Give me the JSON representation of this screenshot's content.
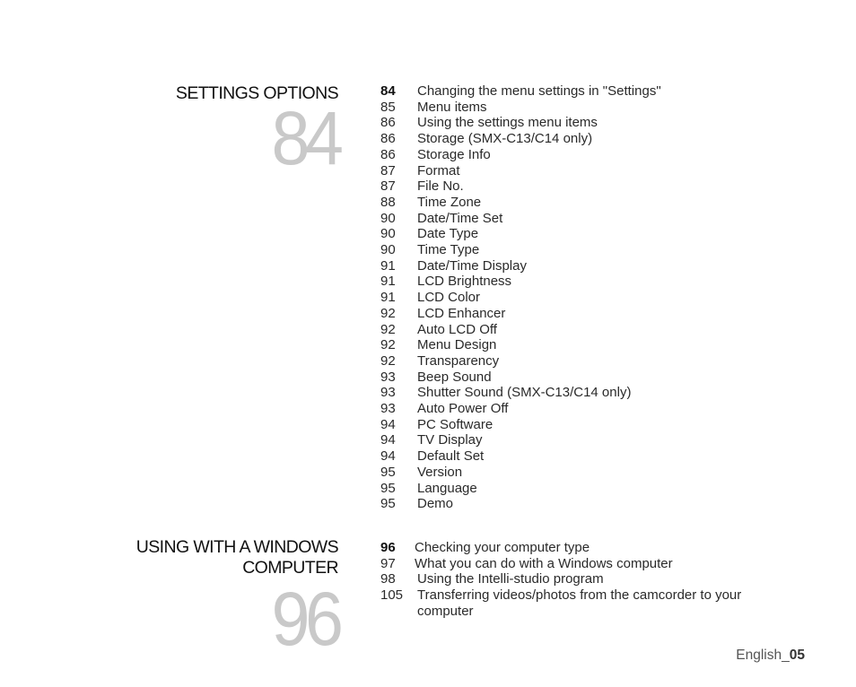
{
  "sections": [
    {
      "title": "SETTINGS OPTIONS",
      "number": "84",
      "items": [
        {
          "page": "84",
          "text": "Changing the menu settings in \"Settings\"",
          "bold": true
        },
        {
          "page": "85",
          "text": "Menu items"
        },
        {
          "page": "86",
          "text": "Using the settings menu items"
        },
        {
          "page": "86",
          "text": "Storage (SMX-C13/C14 only)"
        },
        {
          "page": "86",
          "text": "Storage Info"
        },
        {
          "page": "87",
          "text": "Format"
        },
        {
          "page": "87",
          "text": "File No."
        },
        {
          "page": "88",
          "text": "Time Zone"
        },
        {
          "page": "90",
          "text": "Date/Time Set"
        },
        {
          "page": "90",
          "text": "Date Type"
        },
        {
          "page": "90",
          "text": "Time Type"
        },
        {
          "page": "91",
          "text": "Date/Time Display"
        },
        {
          "page": "91",
          "text": "LCD Brightness"
        },
        {
          "page": "91",
          "text": "LCD Color"
        },
        {
          "page": "92",
          "text": "LCD Enhancer"
        },
        {
          "page": "92",
          "text": "Auto LCD Off"
        },
        {
          "page": "92",
          "text": "Menu Design"
        },
        {
          "page": "92",
          "text": "Transparency"
        },
        {
          "page": "93",
          "text": "Beep Sound"
        },
        {
          "page": "93",
          "text": "Shutter Sound  (SMX-C13/C14 only)"
        },
        {
          "page": "93",
          "text": "Auto Power Off"
        },
        {
          "page": "94",
          "text": "PC Software"
        },
        {
          "page": "94",
          "text": "TV Display"
        },
        {
          "page": "94",
          "text": "Default Set"
        },
        {
          "page": "95",
          "text": "Version"
        },
        {
          "page": "95",
          "text": "Language"
        },
        {
          "page": "95",
          "text": "Demo"
        }
      ]
    },
    {
      "title_line1": "USING WITH A WINDOWS",
      "title_line2": "COMPUTER",
      "number": "96",
      "items": [
        {
          "page": "96",
          "text": "Checking your computer type",
          "bold": true
        },
        {
          "page": "97",
          "text": "What you can do with a Windows computer"
        },
        {
          "page": "98",
          "text": "Using the Intelli-studio program"
        },
        {
          "page": "105",
          "text": "Transferring videos/photos from the camcorder to your computer"
        }
      ]
    }
  ],
  "footer": {
    "language": "English_",
    "page_number": "05"
  }
}
